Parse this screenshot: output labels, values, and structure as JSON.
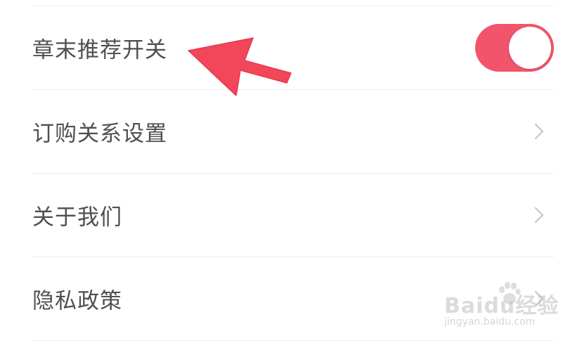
{
  "settings": {
    "items": [
      {
        "label": "章末推荐开关",
        "control": "toggle",
        "toggle_on": true
      },
      {
        "label": "订购关系设置",
        "control": "chevron"
      },
      {
        "label": "关于我们",
        "control": "chevron"
      },
      {
        "label": "隐私政策",
        "control": "chevron"
      }
    ]
  },
  "toggle": {
    "on_color": "#f2546b",
    "knob_color": "#ffffff"
  },
  "annotation": {
    "arrow_color": "#f2465a",
    "target": "章末推荐开关"
  },
  "watermark": {
    "logo": "Baidu经验",
    "url": "jingyan.baidu.com"
  },
  "icons": {
    "chevron": "chevron-right-icon",
    "arrow": "red-arrow-icon",
    "paw": "baidu-paw-icon"
  }
}
